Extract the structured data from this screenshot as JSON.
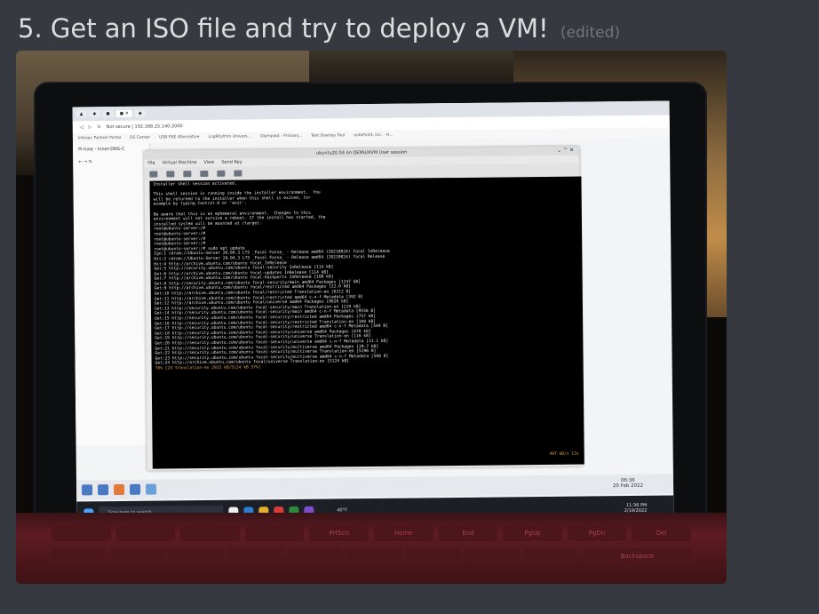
{
  "message": {
    "text": "5. Get an ISO file and try to deploy a VM!",
    "edited_label": "(edited)"
  },
  "browser": {
    "address": "Not secure | 192.168.25.140:2000",
    "favorites": [
      "Infosec Partner Portal",
      "DS Center",
      "USB PXE Alternative",
      "LogRhythm Univers...",
      "Olympiad - Primary...",
      "Text Overlay Tool",
      "ootaPoint, Inc. - H..."
    ],
    "sidebar_item": "Pi-hole - Inner-DNS-C"
  },
  "vm": {
    "title": "ubuntu20.04 on QEMU/KVM User session",
    "menu": [
      "File",
      "Virtual Machine",
      "View",
      "Send Key"
    ],
    "terminal_lines": [
      "Installer shell session activated.",
      "",
      "This shell session is running inside the installer environment.  You",
      "will be returned to the installer when this shell is exited, for",
      "example by typing Control-D or 'exit'.",
      "",
      "Be aware that this is an ephemeral environment.  Changes to this",
      "environment will not survive a reboot. If the install has started, the",
      "installed system will be mounted at /target.",
      "root@ubuntu-server:/#",
      "root@ubuntu-server:/#",
      "root@ubuntu-server:/#",
      "root@ubuntu-server:/#",
      "root@ubuntu-server:/# sudo apt update",
      "Ign:1 cdrom://Ubuntu-Server 20.04.3 LTS _Focal Fossa_ - Release amd64 (20210824) focal InRelease",
      "Hit:2 cdrom://Ubuntu-Server 20.04.3 LTS _Focal Fossa_ - Release amd64 (20210824) focal Release",
      "Hit:4 http://archive.ubuntu.com/ubuntu focal InRelease",
      "Get:5 http://security.ubuntu.com/ubuntu focal-security InRelease [114 kB]",
      "Get:6 http://archive.ubuntu.com/ubuntu focal-updates InRelease [114 kB]",
      "Get:7 http://archive.ubuntu.com/ubuntu focal-backports InRelease [108 kB]",
      "Get:8 http://security.ubuntu.com/ubuntu focal-security/main amd64 Packages [1247 kB]",
      "Get:9 http://archive.ubuntu.com/ubuntu focal/restricted amd64 Packages [22.0 kB]",
      "Get:10 http://archive.ubuntu.com/ubuntu focal/restricted Translation-en [6212 B]",
      "Get:11 http://archive.ubuntu.com/ubuntu focal/restricted amd64 c-n-f Metadata [392 B]",
      "Get:12 http://archive.ubuntu.com/ubuntu focal/universe amd64 Packages [8628 kB]",
      "Get:13 http://security.ubuntu.com/ubuntu focal-security/main Translation-en [219 kB]",
      "Get:14 http://security.ubuntu.com/ubuntu focal-security/main amd64 c-n-f Metadata [9556 B]",
      "Get:15 http://security.ubuntu.com/ubuntu focal-security/restricted amd64 Packages [757 kB]",
      "Get:16 http://security.ubuntu.com/ubuntu focal-security/restricted Translation-en [108 kB]",
      "Get:17 http://security.ubuntu.com/ubuntu focal-security/restricted amd64 c-n-f Metadata [504 B]",
      "Get:18 http://security.ubuntu.com/ubuntu focal-security/universe amd64 Packages [678 kB]",
      "Get:19 http://security.ubuntu.com/ubuntu focal-security/universe Translation-en [116 kB]",
      "Get:20 http://security.ubuntu.com/ubuntu focal-security/universe amd64 c-n-f Metadata [13.1 kB]",
      "Get:21 http://security.ubuntu.com/ubuntu focal-security/multiverse amd64 Packages [20.7 kB]",
      "Get:22 http://security.ubuntu.com/ubuntu focal-security/multiverse Translation-en [5196 B]",
      "Get:23 http://security.ubuntu.com/ubuntu focal-security/multiverse amd64 c-n-f Metadata [500 B]",
      "Get:24 http://archive.ubuntu.com/ubuntu focal/universe Translation-en [5124 kB]"
    ],
    "progress_line": "78% [24 Translation-en 2915 kB/5124 kB 57%]",
    "rate": "497 kB/s 13s"
  },
  "vm_taskbar_clock": {
    "time": "06:36",
    "date": "20 Feb 2022"
  },
  "windows_taskbar": {
    "search_placeholder": "Type here to search",
    "weather": "40°F",
    "time": "11:36 PM",
    "date": "2/19/2022"
  },
  "keyboard_labels": [
    "PrtScn",
    "Home",
    "End",
    "PgUp",
    "PgDn",
    "Del",
    "Backspace"
  ]
}
